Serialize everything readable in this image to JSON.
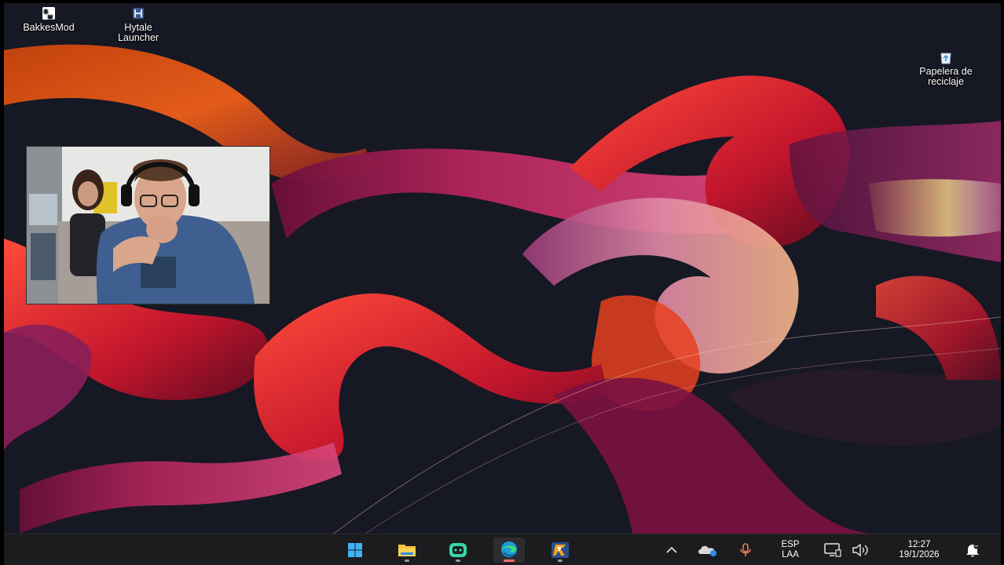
{
  "desktop": {
    "icons": [
      {
        "label": "BakkesMod"
      },
      {
        "label": "Hytale Launcher",
        "line1": "Hytale",
        "line2": "Launcher"
      },
      {
        "label": "Papelera de reciclaje",
        "line1": "Papelera de",
        "line2": "reciclaje"
      }
    ]
  },
  "taskbar": {
    "apps": [
      {
        "icon": "windows-start-icon"
      },
      {
        "icon": "file-explorer-icon"
      },
      {
        "icon": "streaming-app-icon"
      },
      {
        "icon": "edge-browser-icon",
        "active": true
      },
      {
        "icon": "counter-strike-icon"
      }
    ],
    "tray": {
      "language_line1": "ESP",
      "language_line2": "LAA",
      "time": "12:27",
      "date": "19/1/2026"
    }
  },
  "colors": {
    "taskbar_bg": "#1c1c1f",
    "desktop_bg": "#161824",
    "edge_active_indicator": "#ff6d6d"
  }
}
